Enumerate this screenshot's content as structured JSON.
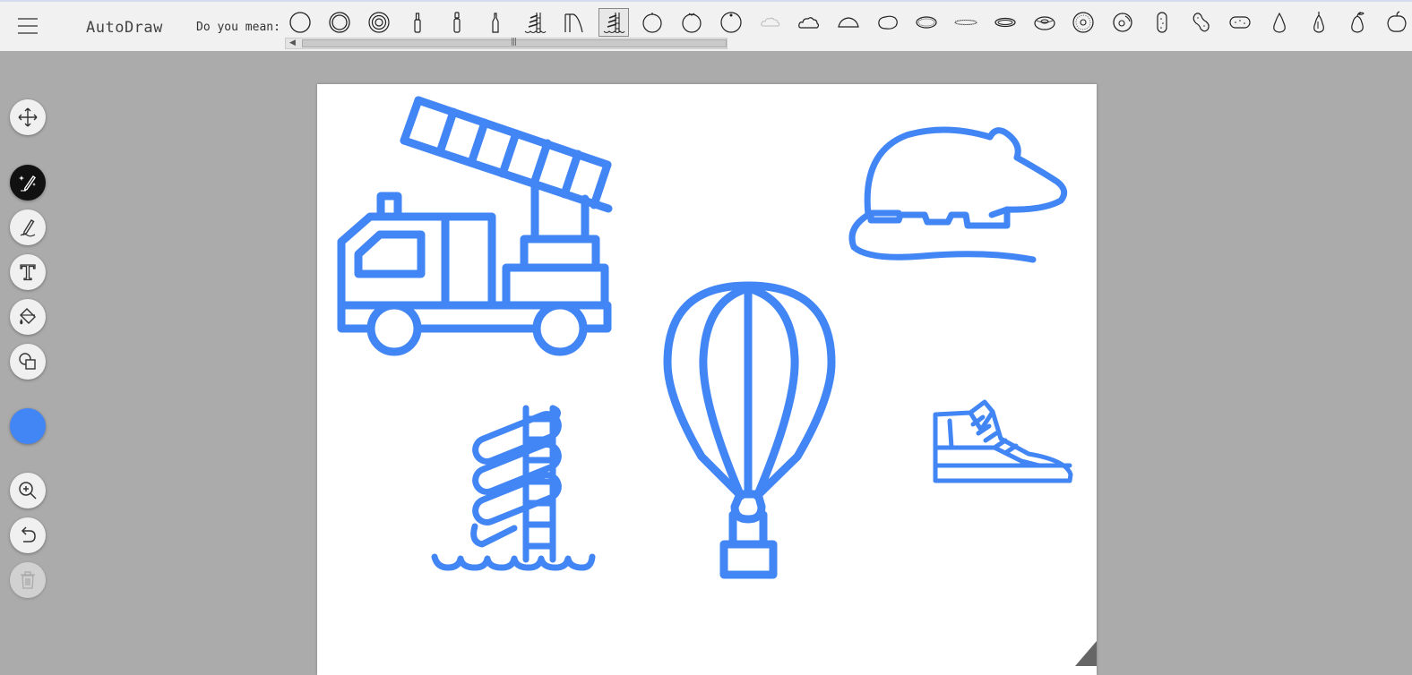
{
  "app": {
    "title": "AutoDraw"
  },
  "suggestions": {
    "label": "Do you mean:",
    "items": [
      {
        "icon": "circle-icon"
      },
      {
        "icon": "double-circle-icon"
      },
      {
        "icon": "triple-circle-icon"
      },
      {
        "icon": "bottle-icon"
      },
      {
        "icon": "bottle-icon"
      },
      {
        "icon": "bottle-icon"
      },
      {
        "icon": "water-slide-icon"
      },
      {
        "icon": "slide-icon"
      },
      {
        "icon": "water-slide-icon",
        "selected": true
      },
      {
        "icon": "round-fruit-icon"
      },
      {
        "icon": "round-fruit-icon"
      },
      {
        "icon": "round-fruit-icon"
      },
      {
        "icon": "cloud-icon"
      },
      {
        "icon": "cloud-icon"
      },
      {
        "icon": "mound-icon"
      },
      {
        "icon": "blob-icon"
      },
      {
        "icon": "oval-ring-icon"
      },
      {
        "icon": "flat-oval-icon"
      },
      {
        "icon": "flat-ring-icon"
      },
      {
        "icon": "donut-icon"
      },
      {
        "icon": "donut-sprinkles-icon"
      },
      {
        "icon": "bagel-icon"
      },
      {
        "icon": "pickle-icon"
      },
      {
        "icon": "peanut-icon"
      },
      {
        "icon": "bean-icon"
      },
      {
        "icon": "pear-icon"
      },
      {
        "icon": "pear-icon"
      },
      {
        "icon": "apple-pear-icon"
      },
      {
        "icon": "round-fruit-icon"
      }
    ]
  },
  "tools": [
    {
      "name": "move-tool",
      "icon": "move-arrows-icon"
    },
    {
      "name": "autodraw-tool",
      "icon": "autodraw-sparkle-icon",
      "active": true
    },
    {
      "name": "draw-tool",
      "icon": "pencil-icon"
    },
    {
      "name": "type-tool",
      "icon": "text-t-icon"
    },
    {
      "name": "fill-tool",
      "icon": "paint-bucket-icon"
    },
    {
      "name": "shape-tool",
      "icon": "shapes-icon"
    },
    {
      "name": "zoom-tool",
      "icon": "zoom-in-icon"
    },
    {
      "name": "undo-tool",
      "icon": "undo-icon"
    },
    {
      "name": "delete-tool",
      "icon": "trash-icon",
      "disabled": true
    }
  ],
  "current_color": "#4285f4",
  "canvas_drawings": [
    {
      "name": "fire-truck-drawing"
    },
    {
      "name": "rat-drawing"
    },
    {
      "name": "hot-air-balloon-drawing"
    },
    {
      "name": "water-slide-drawing"
    },
    {
      "name": "sneaker-drawing"
    }
  ]
}
